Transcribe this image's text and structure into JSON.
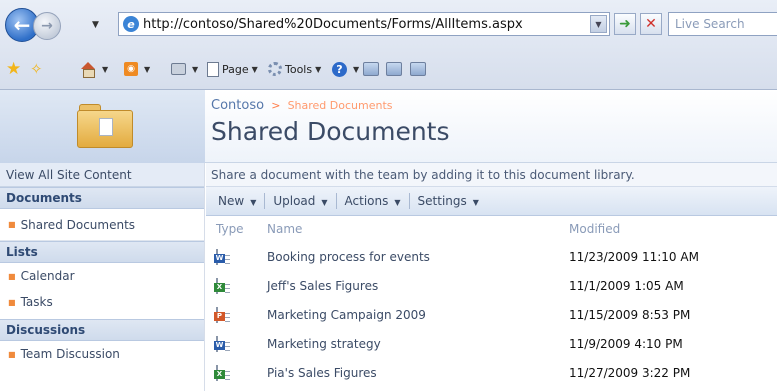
{
  "browser": {
    "url": "http://contoso/Shared%20Documents/Forms/AllItems.aspx",
    "search_placeholder": "Live Search",
    "toolbar": {
      "page_label": "Page",
      "tools_label": "Tools"
    }
  },
  "site": {
    "breadcrumb_site": "Contoso",
    "breadcrumb_sep": ">",
    "breadcrumb_current": "Shared Documents",
    "page_title": "Shared Documents",
    "description": "Share a document with the team by adding it to this document library."
  },
  "sidebar": {
    "view_all": "View All Site Content",
    "sections": [
      {
        "heading": "Documents",
        "items": [
          "Shared Documents"
        ]
      },
      {
        "heading": "Lists",
        "items": [
          "Calendar",
          "Tasks"
        ]
      },
      {
        "heading": "Discussions",
        "items": [
          "Team Discussion"
        ]
      }
    ]
  },
  "actions": {
    "new": "New",
    "upload": "Upload",
    "actions": "Actions",
    "settings": "Settings"
  },
  "list": {
    "columns": {
      "type": "Type",
      "name": "Name",
      "modified": "Modified"
    },
    "rows": [
      {
        "type_icon": "word-doc-icon",
        "name": "Booking process for events",
        "modified": "11/23/2009 11:10 AM"
      },
      {
        "type_icon": "excel-doc-icon",
        "name": "Jeff's Sales Figures",
        "modified": "11/1/2009 1:05 AM"
      },
      {
        "type_icon": "powerpoint-doc-icon",
        "name": "Marketing Campaign 2009",
        "modified": "11/15/2009 8:53 PM"
      },
      {
        "type_icon": "word-doc-icon",
        "name": "Marketing strategy",
        "modified": "11/9/2009 4:10 PM"
      },
      {
        "type_icon": "excel-doc-icon",
        "name": "Pia's Sales Figures",
        "modified": "11/27/2009 3:22 PM"
      }
    ]
  }
}
